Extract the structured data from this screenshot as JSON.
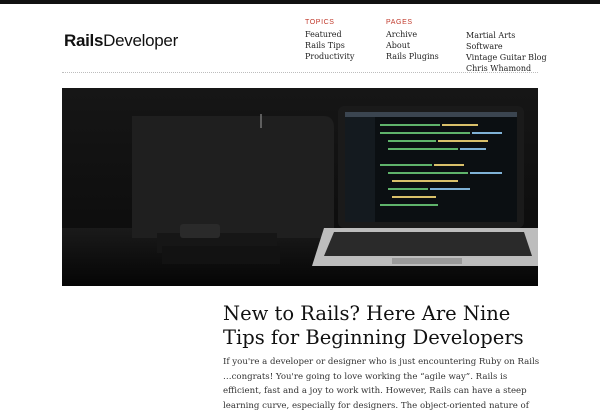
{
  "site": {
    "logo_bold": "Rails",
    "logo_light": "Developer"
  },
  "nav": {
    "topics": {
      "heading": "TOPICS",
      "items": [
        "Featured",
        "Rails Tips",
        "Productivity"
      ]
    },
    "pages": {
      "heading": "PAGES",
      "items": [
        "Archive",
        "About",
        "Rails Plugins"
      ]
    },
    "links": {
      "items": [
        "Martial Arts",
        "Software",
        "Vintage Guitar Blog",
        "Chris Whamond"
      ]
    }
  },
  "post": {
    "title": "New to Rails? Here Are Nine Tips for Beginning Developers",
    "excerpt": "If you're a developer or designer who is just encountering Ruby on Rails …congrats!  You're going to love working the “agile way”.  Rails is efficient, fast and a joy to work with. However, Rails can have a steep learning curve, especially for designers.  The object-oriented nature of"
  },
  "colors": {
    "accent": "#c0392b",
    "topbar": "#111111"
  }
}
